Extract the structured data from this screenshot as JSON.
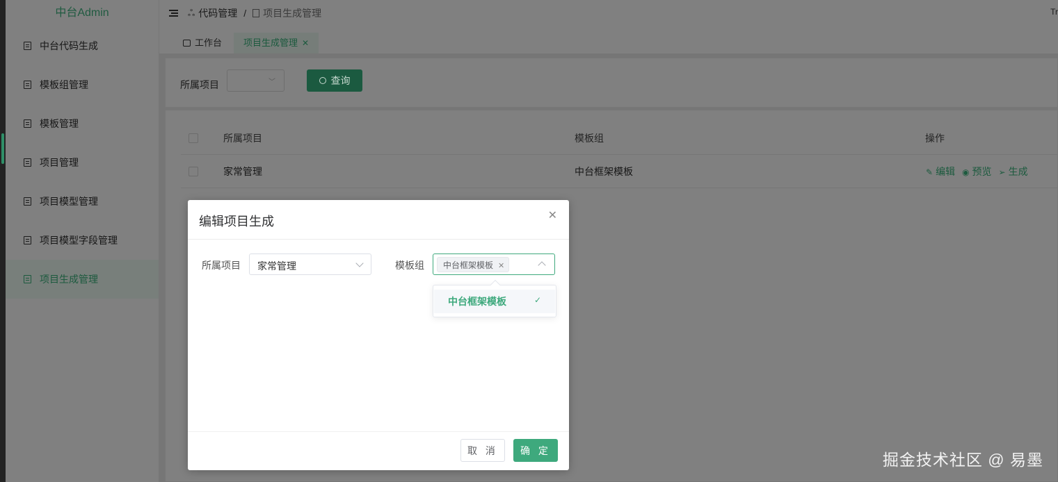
{
  "app": {
    "logo": "中台Admin"
  },
  "sidebar": {
    "items": [
      {
        "label": "中台代码生成"
      },
      {
        "label": "模板组管理"
      },
      {
        "label": "模板管理"
      },
      {
        "label": "项目管理"
      },
      {
        "label": "项目模型管理"
      },
      {
        "label": "项目模型字段管理"
      },
      {
        "label": "项目生成管理",
        "active": true
      }
    ]
  },
  "topbar": {
    "breadcrumb": [
      "代码管理",
      "项目生成管理"
    ],
    "separator": "/",
    "right_text": "Tr"
  },
  "tabs": [
    {
      "label": "工作台"
    },
    {
      "label": "项目生成管理",
      "active": true
    }
  ],
  "search": {
    "label": "所属项目",
    "select_value": "",
    "button_label": "查询"
  },
  "table": {
    "headers": [
      "所属项目",
      "模板组",
      "操作"
    ],
    "rows": [
      {
        "project": "家常管理",
        "template_group": "中台框架模板"
      }
    ],
    "actions": [
      "编辑",
      "预览",
      "生成"
    ]
  },
  "modal": {
    "title": "编辑项目生成",
    "project_label": "所属项目",
    "project_value": "家常管理",
    "template_group_label": "模板组",
    "template_group_tag": "中台框架模板",
    "dropdown_options": [
      {
        "label": "中台框架模板",
        "selected": true
      }
    ],
    "cancel_label": "取 消",
    "ok_label": "确 定"
  },
  "watermark": "掘金技术社区 @ 易墨",
  "colors": {
    "primary": "#3ea97d",
    "primary_dim": "#1b5a40",
    "overlay_bg": "#7d7d7d"
  }
}
